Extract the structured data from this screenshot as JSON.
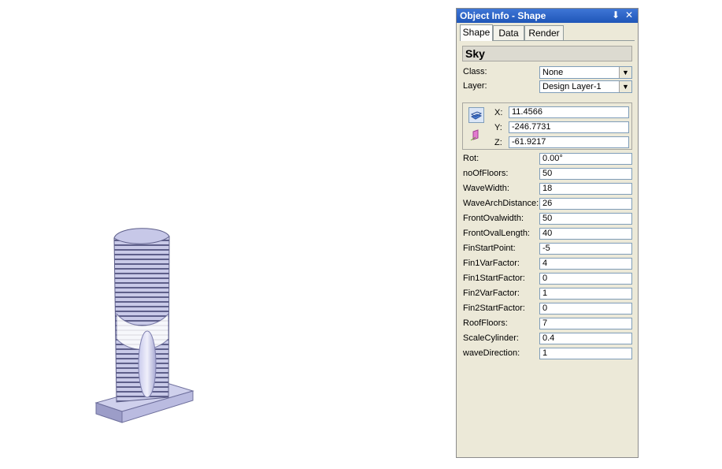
{
  "palette": {
    "title": "Object Info - Shape",
    "pin_glyph": "⬇",
    "close_glyph": "✕",
    "tabs": [
      {
        "label": "Shape",
        "active": true
      },
      {
        "label": "Data",
        "active": false
      },
      {
        "label": "Render",
        "active": false
      }
    ],
    "object_name": "Sky",
    "class": {
      "label": "Class:",
      "value": "None"
    },
    "layer": {
      "label": "Layer:",
      "value": "Design Layer-1"
    },
    "position": {
      "x": {
        "label": "X:",
        "value": "11.4566"
      },
      "y": {
        "label": "Y:",
        "value": "-246.7731"
      },
      "z": {
        "label": "Z:",
        "value": "-61.9217"
      }
    },
    "params": [
      {
        "label": "Rot:",
        "value": "0.00°"
      },
      {
        "label": "noOfFloors:",
        "value": "50"
      },
      {
        "label": "WaveWidth:",
        "value": "18"
      },
      {
        "label": "WaveArchDistance:",
        "value": "26"
      },
      {
        "label": "FrontOvalwidth:",
        "value": "50"
      },
      {
        "label": "FrontOvalLength:",
        "value": "40"
      },
      {
        "label": "FinStartPoint:",
        "value": "-5"
      },
      {
        "label": "Fin1VarFactor:",
        "value": "4"
      },
      {
        "label": "Fin1StartFactor:",
        "value": "0"
      },
      {
        "label": "Fin2VarFactor:",
        "value": "1"
      },
      {
        "label": "Fin2StartFactor:",
        "value": "0"
      },
      {
        "label": "RoofFloors:",
        "value": "7"
      },
      {
        "label": "ScaleCylinder:",
        "value": "0.4"
      },
      {
        "label": "waveDirection:",
        "value": "1"
      }
    ]
  },
  "colors": {
    "tower_fill": "#b5b6dc",
    "tower_dark": "#6e6f9c",
    "tower_light": "#d9daf0",
    "titlebar": "#2a62c9",
    "panel_bg": "#ece9d8"
  },
  "icons": [
    "3d-plane-icon",
    "2d-plane-icon",
    "dropdown-arrow-icon"
  ]
}
